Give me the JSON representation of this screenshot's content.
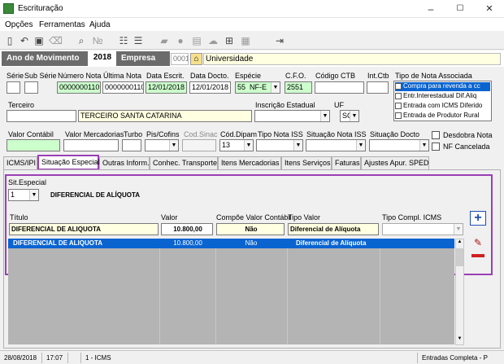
{
  "window": {
    "title": "Escrituração",
    "minimize": "–",
    "maximize": "☐",
    "close": "✕"
  },
  "menu": [
    "Opções",
    "Ferramentas",
    "Ajuda"
  ],
  "header": {
    "ano_label": "Ano de Movimento",
    "ano_value": "2018",
    "empresa_label": "Empresa",
    "empresa_code": "0001",
    "empresa_name": "Universidade"
  },
  "form": {
    "serie_label": "Série",
    "subserie_label": "Sub Série",
    "numero_nota_label": "Número Nota",
    "numero_nota": "0000000110",
    "ultima_nota_label": "Última Nota",
    "ultima_nota": "0000000110",
    "data_escrit_label": "Data Escrit.",
    "data_escrit": "12/01/2018",
    "data_docto_label": "Data Docto.",
    "data_docto": "12/01/2018",
    "especie_label": "Espécie",
    "especie_code": "55",
    "especie_value": "NF-E",
    "cfo_label": "C.F.O.",
    "cfo_value": "2551",
    "codigo_ctb_label": "Código CTB",
    "int_ctb_label": "Int.Ctb",
    "tipo_nota_assoc_label": "Tipo de Nota Associada",
    "tipo_nota_assoc_items": [
      "Compra para revenda a cc",
      "Entr.Interestadual Dif.Aliq",
      "Entrada com ICMS Diferido",
      "Entrada de Produtor Rural"
    ],
    "terceiro_label": "Terceiro",
    "terceiro_name": "TERCEIRO SANTA CATARINA",
    "inscricao_label": "Inscrição Estadual",
    "uf_label": "UF",
    "uf_value": "SC",
    "valor_contabil_label": "Valor Contábil",
    "valor_mercadorias_label": "Valor Mercadorias",
    "turbo_label": "Turbo",
    "pis_cofins_label": "Pis/Cofins",
    "cod_sinac_label": "Cod.Sinac",
    "cod_dipam_label": "Cód.Dipam",
    "cod_dipam_value": "13",
    "tipo_nota_iss_label": "Tipo Nota ISS",
    "situacao_nota_iss_label": "Situação Nota ISS",
    "situacao_docto_label": "Situação Docto",
    "desdobra_label": "Desdobra Nota",
    "nf_cancelada_label": "NF Cancelada"
  },
  "tabs": [
    "ICMS/IPI",
    "Situação Especial",
    "Outras Inform.",
    "Conhec. Transporte",
    "Itens Mercadorias",
    "Itens Serviços",
    "Faturas",
    "Ajustes Apur. SPED"
  ],
  "situacao": {
    "sit_label": "Sit.Especial",
    "sit_value": "1",
    "sit_desc": "DIFERENCIAL DE ALÍQUOTA",
    "titulo_label": "Título",
    "titulo_value": "DIFERENCIAL DE ALIQUOTA",
    "valor_label": "Valor",
    "valor_value": "10.800,00",
    "compoe_label": "Compõe Valor Contábil",
    "compoe_value": "Não",
    "tipo_valor_label": "Tipo Valor",
    "tipo_valor_value": "Diferencial de Alíquota",
    "tipo_compl_label": "Tipo Compl. ICMS",
    "row": {
      "titulo": "DIFERENCIAL DE ALIQUOTA",
      "valor": "10.800,00",
      "compoe": "Não",
      "tipo": "Diferencial de Alíquota"
    }
  },
  "status": {
    "date": "28/08/2018",
    "time": "17:07",
    "tab": "1 - ICMS",
    "mode": "Entradas Completa - P"
  },
  "colors": {
    "accent": "#0a64d0",
    "highlight": "#9b3fb4",
    "header": "#6b6b6b"
  }
}
